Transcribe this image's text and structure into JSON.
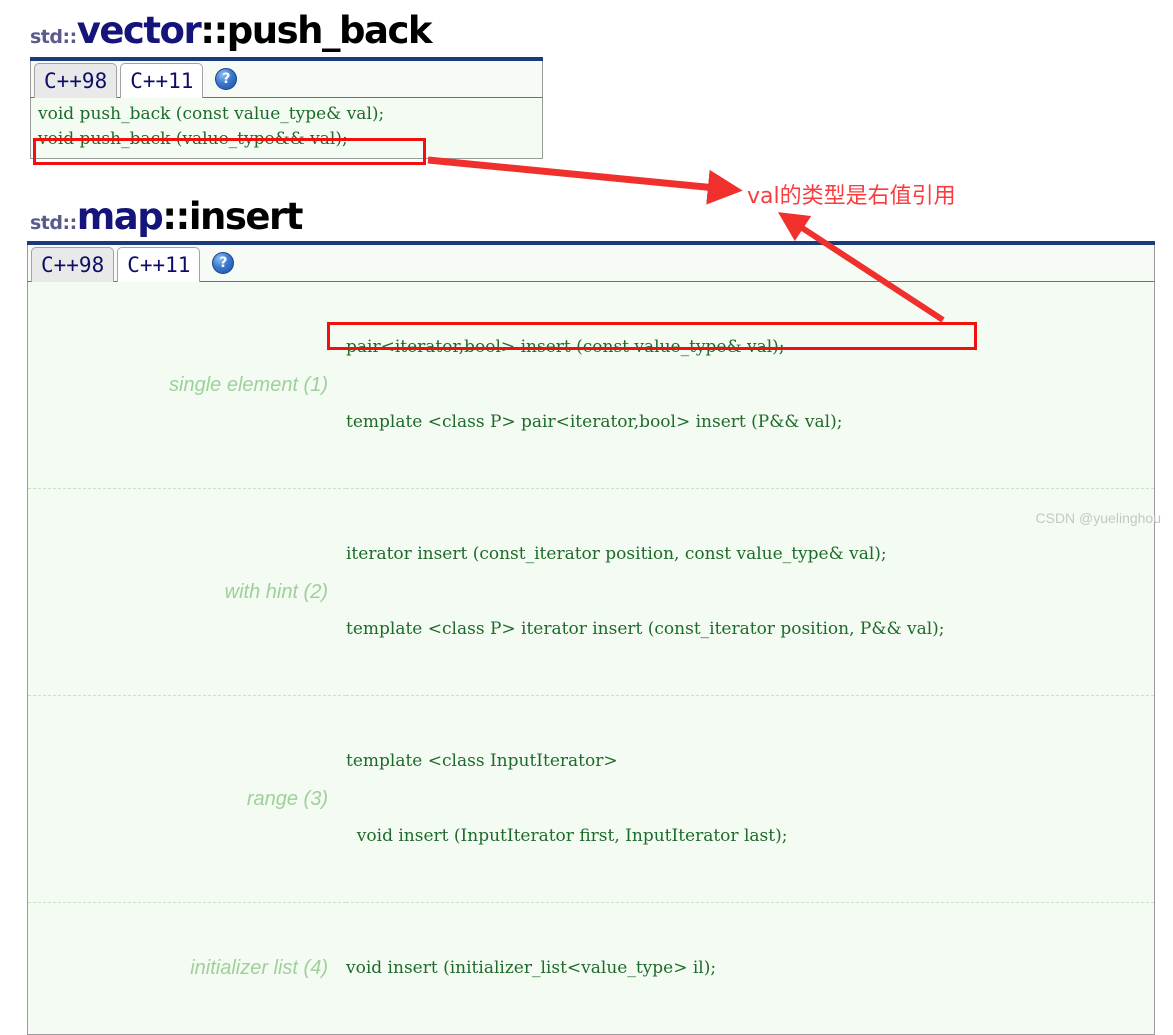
{
  "sections": [
    {
      "title": {
        "namespace": "std::",
        "class": "vector",
        "separator": "::",
        "member": "push_back"
      },
      "tabs": [
        {
          "label": "C++98",
          "active": false
        },
        {
          "label": "C++11",
          "active": true
        }
      ],
      "help_icon": {
        "glyph": "?",
        "name": "help-icon"
      },
      "signatures": [
        "void push_back (const value_type& val);",
        "void push_back (value_type&& val);"
      ]
    },
    {
      "title": {
        "namespace": "std::",
        "class": "map",
        "separator": "::",
        "member": "insert"
      },
      "tabs": [
        {
          "label": "C++98",
          "active": false
        },
        {
          "label": "C++11",
          "active": true
        }
      ],
      "help_icon": {
        "glyph": "?",
        "name": "help-icon"
      },
      "rows": [
        {
          "label": "single element (1)",
          "lines": [
            "pair<iterator,bool> insert (const value_type& val);",
            "template <class P> pair<iterator,bool> insert (P&& val);"
          ]
        },
        {
          "label": "with hint (2)",
          "lines": [
            "iterator insert (const_iterator position, const value_type& val);",
            "template <class P> iterator insert (const_iterator position, P&& val);"
          ]
        },
        {
          "label": "range (3)",
          "lines": [
            "template <class InputIterator>",
            "  void insert (InputIterator first, InputIterator last);"
          ]
        },
        {
          "label": "initializer list (4)",
          "lines": [
            "void insert (initializer_list<value_type> il);"
          ]
        }
      ]
    }
  ],
  "annotations": {
    "note_text": "val的类型是右值引用",
    "highlight_color": "#f01010",
    "note_color": "#fa3c3c"
  },
  "watermark": "CSDN @yuelinghou"
}
